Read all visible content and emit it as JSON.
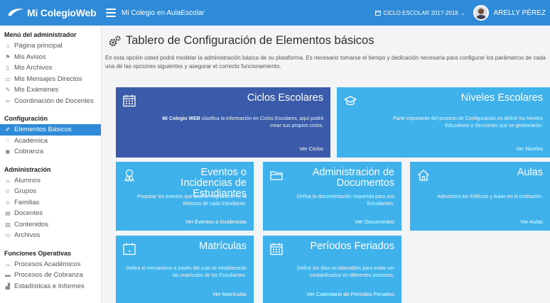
{
  "brand": {
    "name": "Mi ColegioWeb"
  },
  "header": {
    "site_title": "Mi Colegio en AulaEscolar",
    "cycle": "CICLO ESCOLAR 2017-2018",
    "user": "ARELLY PÉREZ"
  },
  "sidebar": {
    "sections": [
      {
        "title": "Menú del administrador",
        "items": [
          {
            "label": "Página principal",
            "icon": "home-icon"
          },
          {
            "label": "Mis Avisos",
            "icon": "flag-icon"
          },
          {
            "label": "Mis Archivos",
            "icon": "file-icon"
          },
          {
            "label": "Mis Mensajes Directos",
            "icon": "message-icon"
          },
          {
            "label": "Mis Exámenes",
            "icon": "edit-icon"
          },
          {
            "label": "Coordinación de Docentes",
            "icon": "link-icon"
          }
        ]
      },
      {
        "title": "Configuración",
        "items": [
          {
            "label": "Elementos Básicos",
            "icon": "wrench-icon",
            "active": true
          },
          {
            "label": "Académica",
            "icon": "bulb-icon"
          },
          {
            "label": "Cobranza",
            "icon": "card-icon"
          }
        ]
      },
      {
        "title": "Administración",
        "items": [
          {
            "label": "Alumnos",
            "icon": "cap-icon"
          },
          {
            "label": "Grupos",
            "icon": "users-icon"
          },
          {
            "label": "Familias",
            "icon": "family-icon"
          },
          {
            "label": "Docentes",
            "icon": "id-icon"
          },
          {
            "label": "Contenidos",
            "icon": "image-icon"
          },
          {
            "label": "Archivos",
            "icon": "folder-icon"
          }
        ]
      },
      {
        "title": "Funciones Operativas",
        "items": [
          {
            "label": "Procesos Académicos",
            "icon": "cap-icon"
          },
          {
            "label": "Procesos de Cobranza",
            "icon": "card-icon"
          },
          {
            "label": "Estadísticas e Informes",
            "icon": "chart-icon"
          }
        ]
      }
    ]
  },
  "main": {
    "title": "Tablero de Configuración de Elementos básicos",
    "intro": "En esta opción usted podrá modelar la administración básica de su plataforma. Es necesario tomarse el tiempo y dedicación necesaria para configurar los parámetros de cada una de las opciones siguientes y asegurar el correcto funcionamiento.",
    "cards": [
      {
        "title": "Ciclos Escolares",
        "desc_bold": "Mi Colegio WEB",
        "desc": " clasifica la información en Ciclos Escolares, aquí podrá crear sus propios ciclos.",
        "link": "Ver Ciclos",
        "icon": "calendar-icon"
      },
      {
        "title": "Niveles Escolares",
        "desc": "Parte importante del proceso de Configuración es definir los Niveles Educativos o Secciones que se gestionarán.",
        "link": "Ver Niveles",
        "icon": "graduation-cap-icon"
      },
      {
        "title": "Eventos o Incidencias de Estudiantes",
        "desc": "Preparar los eventos que podrán registrarse en la Bitácora de cada Estudiante.",
        "link": "Ver Eventos o Incidencias",
        "icon": "ribbon-icon"
      },
      {
        "title": "Administración de Documentos",
        "desc": "Defina la documentación requerida para sus Estudiantes.",
        "link": "Ver Documentos",
        "icon": "folder-icon"
      },
      {
        "title": "Aulas",
        "desc": "Administra los Edificios y Aulas en la institución.",
        "link": "Ver Aulas",
        "icon": "home-icon"
      },
      {
        "title": "Matrículas",
        "desc": "Defina el mecanismo a través del cual se establecerán las matrículas de los Estudiantes.",
        "link": "Ver Matrículas",
        "icon": "calendar-blank-icon"
      },
      {
        "title": "Períodos Feriados",
        "desc": "Definir los días no laborables para evitar ser contabilizados en diferentes procesos.",
        "link": "Ver Calendario de Períodos Feriados",
        "icon": "calendar-icon"
      }
    ]
  },
  "colors": {
    "topbar": "#2f8bd8",
    "card": "#3fb2ec",
    "card_dark": "#3a5ba9",
    "active": "#2f8bd8"
  }
}
